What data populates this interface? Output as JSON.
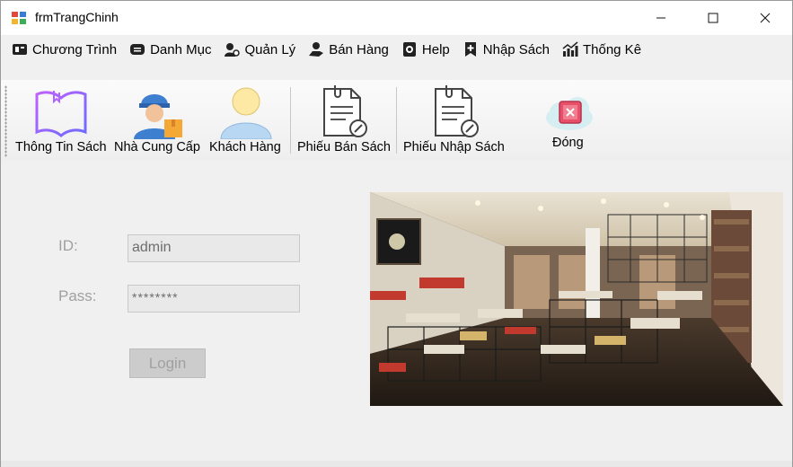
{
  "window": {
    "title": "frmTrangChinh",
    "controls": [
      "minimize",
      "maximize",
      "close"
    ]
  },
  "menu": {
    "items": [
      {
        "label": "Chương Trình",
        "icon": "program-icon"
      },
      {
        "label": "Danh Mục",
        "icon": "category-icon"
      },
      {
        "label": "Quản Lý",
        "icon": "manage-icon"
      },
      {
        "label": "Bán Hàng",
        "icon": "sales-icon"
      },
      {
        "label": "Help",
        "icon": "help-icon"
      },
      {
        "label": "Nhập Sách",
        "icon": "import-books-icon"
      },
      {
        "label": "Thống Kê",
        "icon": "statistics-icon"
      }
    ]
  },
  "toolbar": {
    "buttons": [
      {
        "label": "Thông Tin Sách",
        "icon": "open-book-icon"
      },
      {
        "label": "Nhà Cung Cấp",
        "icon": "supplier-worker-icon"
      },
      {
        "label": "Khách Hàng",
        "icon": "customer-user-icon"
      },
      {
        "label": "Phiếu Bán Sách",
        "icon": "sales-slip-document-icon"
      },
      {
        "label": "Phiếu Nhập Sách",
        "icon": "import-slip-document-icon"
      },
      {
        "label": "Đóng",
        "icon": "close-cloud-icon"
      }
    ]
  },
  "login": {
    "id_label": "ID:",
    "pass_label": "Pass:",
    "id_value": "admin",
    "pass_value": "********",
    "button_label": "Login"
  },
  "colors": {
    "window_bg": "#f0f0f0",
    "disabled_text": "#a0a0a0",
    "input_bg": "#e9e9e9"
  }
}
